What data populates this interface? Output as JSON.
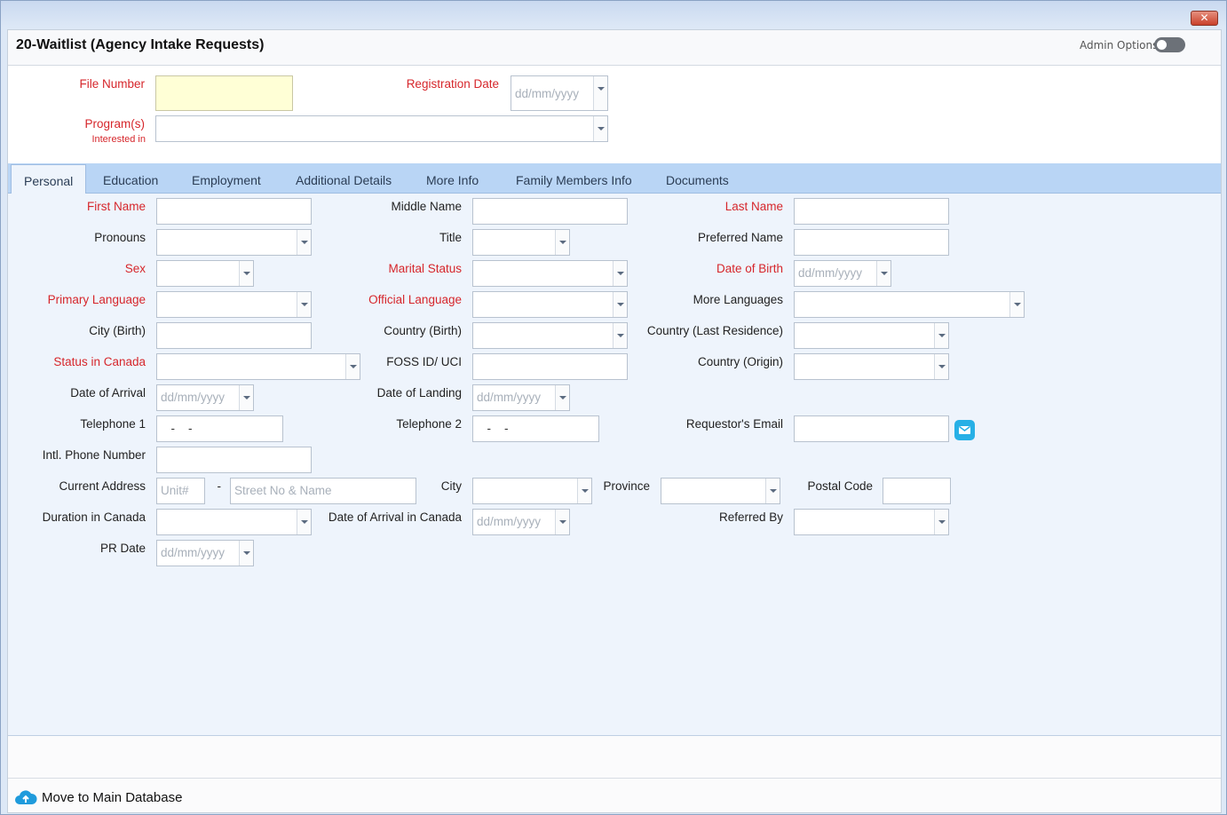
{
  "window": {
    "close_label": "✕"
  },
  "title": "20-Waitlist (Agency Intake Requests)",
  "admin_options_label": "Admin Options",
  "header": {
    "file_number_label": "File Number",
    "registration_date_label": "Registration Date",
    "registration_date_placeholder": "dd/mm/yyyy",
    "programs_label": "Program(s)",
    "programs_sublabel": "Interested in"
  },
  "tabs": [
    {
      "label": "Personal"
    },
    {
      "label": "Education"
    },
    {
      "label": "Employment"
    },
    {
      "label": "Additional Details"
    },
    {
      "label": "More Info"
    },
    {
      "label": "Family Members Info"
    },
    {
      "label": "Documents"
    }
  ],
  "personal": {
    "first_name": "First Name",
    "middle_name": "Middle Name",
    "last_name": "Last Name",
    "pronouns": "Pronouns",
    "title": "Title",
    "preferred_name": "Preferred Name",
    "sex": "Sex",
    "marital_status": "Marital Status",
    "date_of_birth": "Date of Birth",
    "primary_language": "Primary Language",
    "official_language": "Official Language",
    "more_languages": "More Languages",
    "city_birth": "City (Birth)",
    "country_birth": "Country (Birth)",
    "country_last_residence": "Country (Last Residence)",
    "status_in_canada": "Status in Canada",
    "foss_id": "FOSS ID/ UCI",
    "country_origin": "Country (Origin)",
    "date_of_arrival": "Date of Arrival",
    "date_of_landing": "Date of Landing",
    "telephone1": "Telephone 1",
    "telephone2": "Telephone 2",
    "requestors_email": "Requestor's Email",
    "intl_phone": "Intl. Phone Number",
    "current_address": "Current Address",
    "city": "City",
    "province": "Province",
    "postal_code": "Postal Code",
    "duration_in_canada": "Duration in Canada",
    "date_of_arrival_in_canada": "Date of Arrival in Canada",
    "referred_by": "Referred By",
    "pr_date": "PR Date",
    "date_placeholder": "dd/mm/yyyy",
    "phone_mask": "  -    -",
    "unit_placeholder": "Unit#",
    "address_dash": "-",
    "street_placeholder": "Street No & Name"
  },
  "footer": {
    "move_label": "Move to Main Database"
  },
  "colors": {
    "required": "#d6262b",
    "tab_strip": "#b9d5f5",
    "tab_body": "#eef4fc",
    "email_icon": "#27b0e6"
  }
}
